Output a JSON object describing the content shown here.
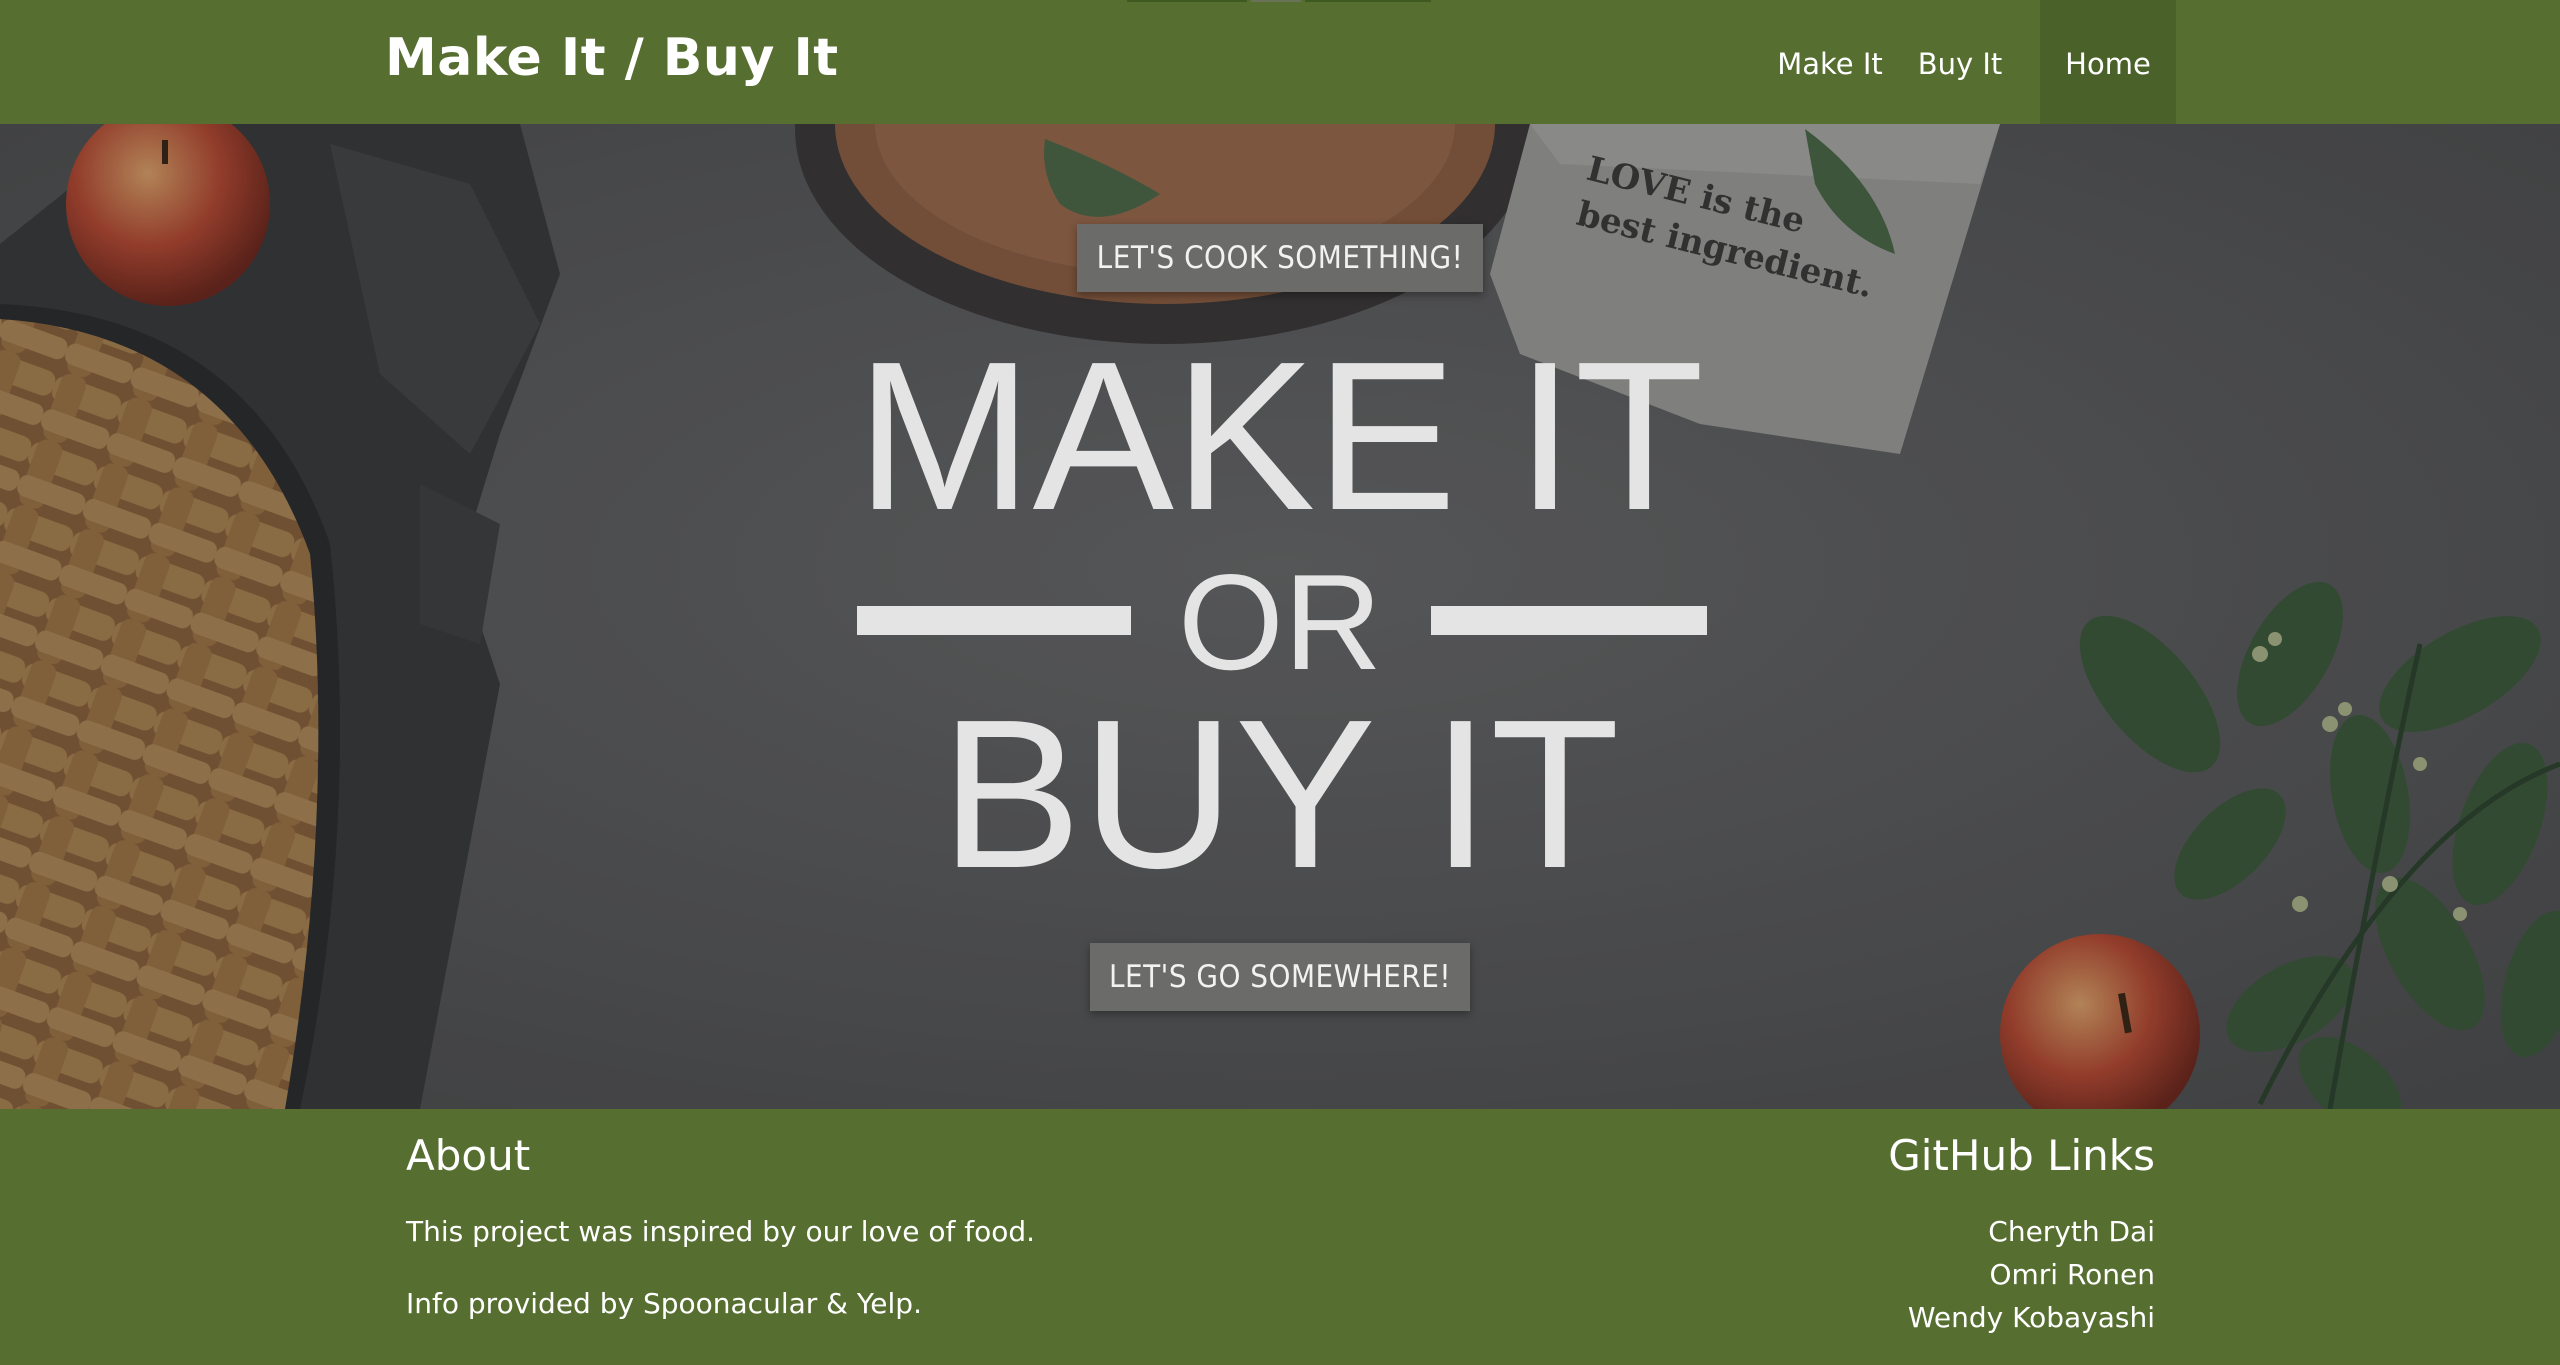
{
  "navbar": {
    "brand": "Make It / Buy It",
    "links": [
      {
        "label": "Make It",
        "active": false
      },
      {
        "label": "Buy It",
        "active": false
      },
      {
        "label": "Home",
        "active": true
      }
    ]
  },
  "hero": {
    "cook_button": "LET'S COOK SOMETHING!",
    "title_line1": "MAKE IT",
    "title_line2": "OR",
    "title_line3": "BUY IT",
    "go_button": "LET'S GO SOMEWHERE!",
    "napkin_text_line1": "LOVE is the",
    "napkin_text_line2": "best ingredient."
  },
  "footer": {
    "about_heading": "About",
    "about_text": "This project was inspired by our love of food.",
    "info_text": "Info provided by Spoonacular & Yelp.",
    "github_heading": "GitHub Links",
    "github_links": [
      "Cheryth Dai",
      "Omri Ronen",
      "Wendy Kobayashi"
    ]
  },
  "colors": {
    "nav_green": "#566e30",
    "nav_active": "#4a6229",
    "hero_overlay": "#5c5d5f",
    "button_gray": "#6b6b6a",
    "title_text": "#e4e4e4"
  }
}
